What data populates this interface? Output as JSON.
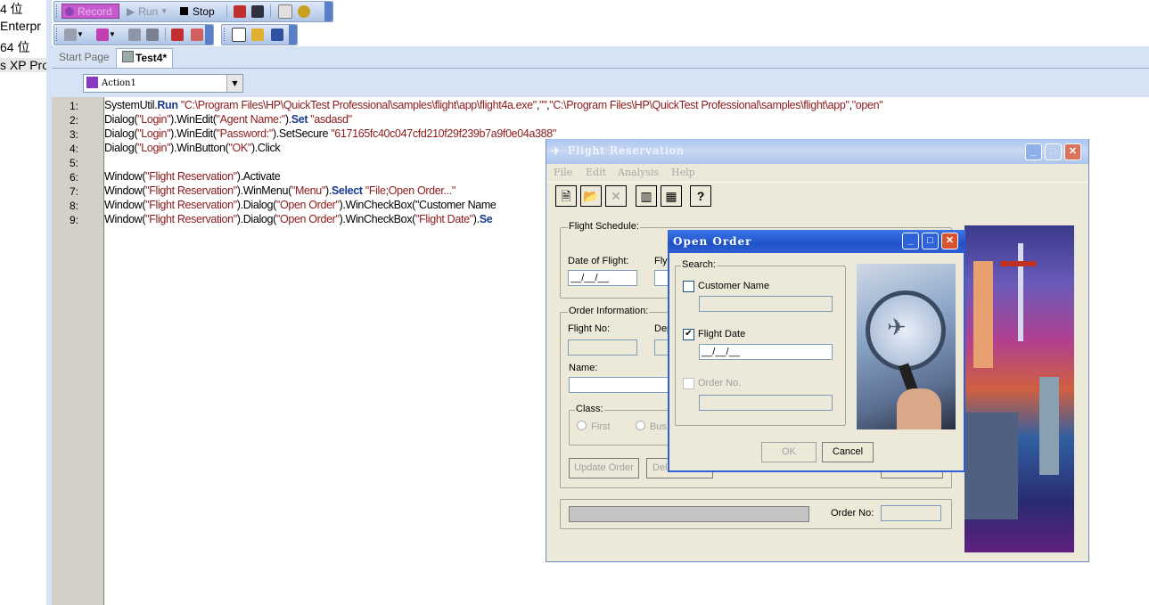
{
  "left_panel": {
    "items": [
      "4 位",
      "Enterpr",
      "64 位",
      "s XP Pro"
    ]
  },
  "toolbar1": {
    "record": "Record",
    "run": "Run",
    "stop": "Stop"
  },
  "tabs": {
    "start_page": "Start Page",
    "test": "Test4*"
  },
  "action": {
    "selected": "Action1"
  },
  "editor": {
    "line_numbers": [
      "1:",
      "2:",
      "3:",
      "4:",
      "5:",
      "6:",
      "7:",
      "8:",
      "9:"
    ],
    "lines": [
      {
        "a": "SystemUtil.",
        "b": "Run",
        "c": " \"C:\\Program Files\\HP\\QuickTest Professional\\samples\\flight\\app\\flight4a.exe\",\"\",\"C:\\Program Files\\HP\\QuickTest Professional\\samples\\flight\\app\",\"open\""
      },
      {
        "a": "Dialog(\"Login\").WinEdit(\"Agent Name:\").",
        "b": "Set",
        "c": " \"asdasd\""
      },
      {
        "a": "Dialog(\"Login\").WinEdit(\"Password:\").SetSecure \"617165fc40c047cfd210f29f239b7a9f0e04a388\"",
        "b": "",
        "c": ""
      },
      {
        "a": "Dialog(\"Login\").WinButton(\"OK\").Click",
        "b": "",
        "c": ""
      },
      {
        "a": "",
        "b": "",
        "c": ""
      },
      {
        "a": "Window(\"Flight Reservation\").Activate",
        "b": "",
        "c": ""
      },
      {
        "a": "Window(\"Flight Reservation\").WinMenu(\"Menu\").",
        "b": "Select",
        "c": " \"File;Open Order...\""
      },
      {
        "a": "Window(\"Flight Reservation\").Dialog(\"Open Order\").WinCheckBox(\"Customer Name",
        "b": "",
        "c": ""
      },
      {
        "a": "Window(\"Flight Reservation\").Dialog(\"Open Order\").WinCheckBox(\"Flight Date\").",
        "b": "Se",
        "c": ""
      }
    ]
  },
  "flight_window": {
    "title": "Flight Reservation",
    "menu": [
      "File",
      "Edit",
      "Analysis",
      "Help"
    ],
    "flight_schedule": "Flight Schedule:",
    "date_of_flight": "Date of Flight:",
    "date_value": "__/__/__",
    "fly_from": "Fly",
    "order_information": "Order Information:",
    "flight_no": "Flight No:",
    "departure": "Dep",
    "name": "Name:",
    "class": "Class:",
    "class_first": "First",
    "class_business": "Bus",
    "update_order": "Update Order",
    "delete_order": "Del",
    "order_no": "Order No:"
  },
  "open_order": {
    "title": "Open Order",
    "search": "Search:",
    "customer_name": "Customer Name",
    "flight_date": "Flight Date",
    "flight_date_value": "__/__/__",
    "flight_date_checked": true,
    "order_no": "Order No.",
    "ok": "OK",
    "cancel": "Cancel"
  }
}
